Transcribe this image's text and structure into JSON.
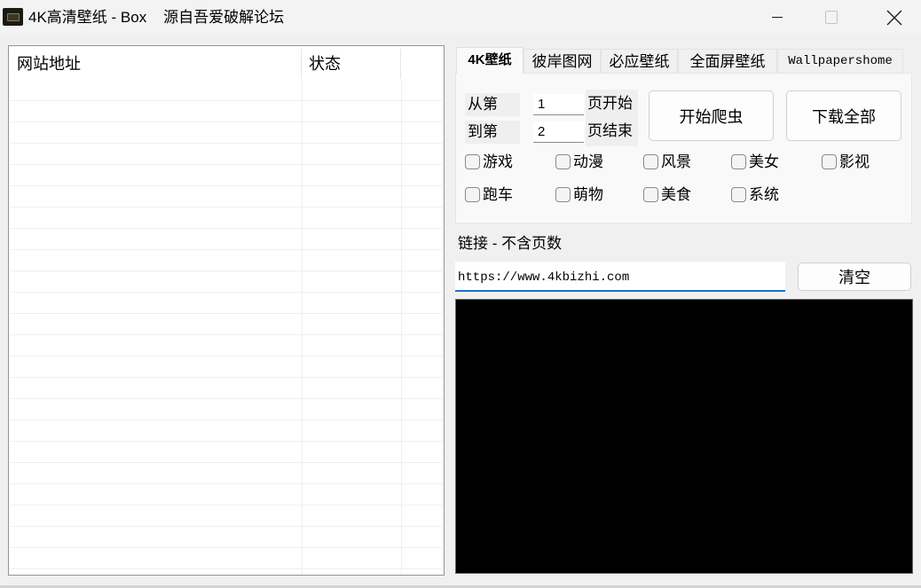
{
  "window": {
    "title": "4K高清壁纸 - Box    源自吾爱破解论坛",
    "app_icon": "wallpaper-app-icon",
    "controls": {
      "minimize": "minimize-icon",
      "maximize": "maximize-icon",
      "close": "close-icon"
    }
  },
  "list": {
    "columns": [
      "网站地址",
      "状态",
      ""
    ],
    "row_count": 23,
    "rows": []
  },
  "tabs": [
    {
      "label": "4K壁纸",
      "active": true
    },
    {
      "label": "彼岸图网",
      "active": false
    },
    {
      "label": "必应壁纸",
      "active": false
    },
    {
      "label": "全面屏壁纸",
      "active": false
    },
    {
      "label": "Wallpapershome",
      "active": false
    }
  ],
  "range": {
    "from_label": "从第",
    "to_label": "到第",
    "from_value": "1",
    "to_value": "2",
    "start_suffix": "页开始",
    "end_suffix": "页结束"
  },
  "buttons": {
    "start_crawl": "开始爬虫",
    "download_all": "下载全部",
    "clear": "清空"
  },
  "categories": [
    {
      "label": "游戏",
      "checked": false
    },
    {
      "label": "动漫",
      "checked": false
    },
    {
      "label": "风景",
      "checked": false
    },
    {
      "label": "美女",
      "checked": false
    },
    {
      "label": "影视",
      "checked": false
    },
    {
      "label": "跑车",
      "checked": false
    },
    {
      "label": "萌物",
      "checked": false
    },
    {
      "label": "美食",
      "checked": false
    },
    {
      "label": "系统",
      "checked": false
    }
  ],
  "link": {
    "label": "链接 - 不含页数",
    "value": "https://www.4kbizhi.com"
  },
  "console": {
    "text": ""
  }
}
